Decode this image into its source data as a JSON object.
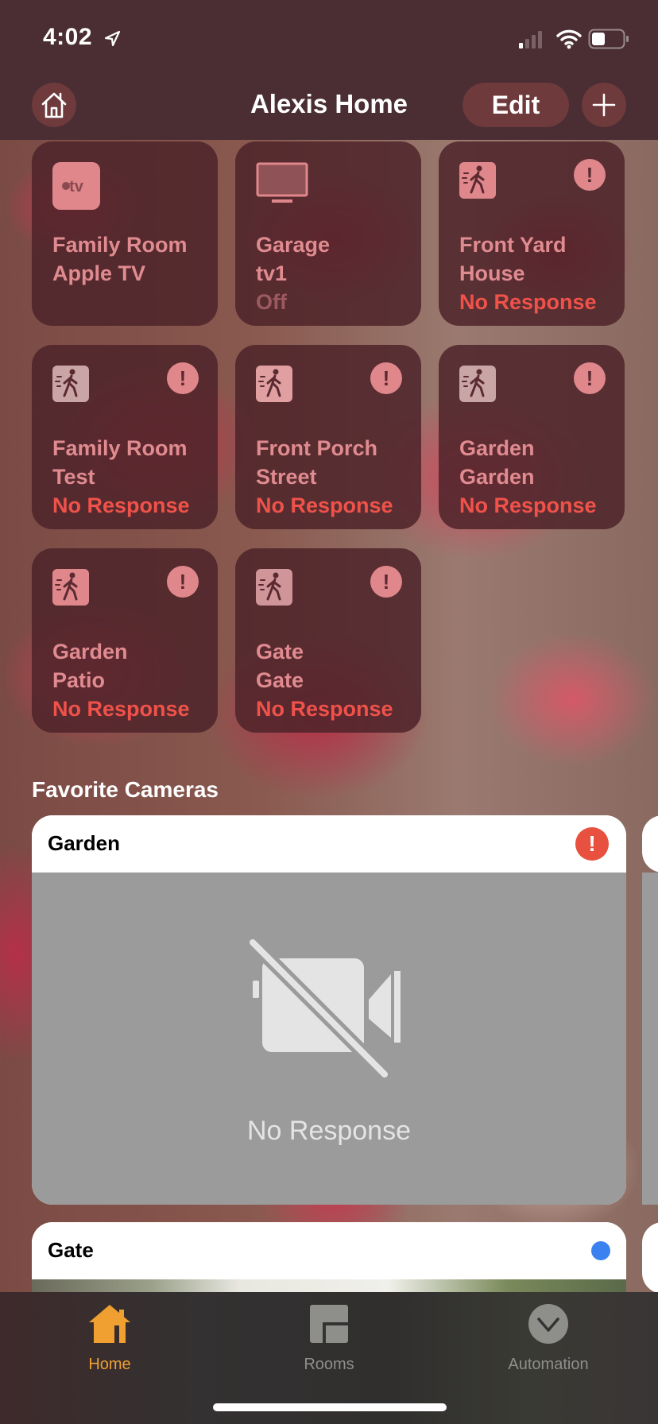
{
  "status_bar": {
    "time": "4:02",
    "icons": [
      "location-arrow-icon",
      "cellular-signal-icon",
      "wifi-icon",
      "battery-icon"
    ]
  },
  "nav": {
    "title": "Alexis Home",
    "edit_label": "Edit",
    "home_icon": "house-icon",
    "add_icon": "plus-icon"
  },
  "accessories": [
    {
      "line1": "Family Room",
      "line2": "Apple TV",
      "status": "",
      "icon": "apple-tv-icon",
      "alert": false
    },
    {
      "line1": "Garage",
      "line2": "tv1",
      "status": "Off",
      "icon": "tv-icon",
      "alert": false
    },
    {
      "line1": "Front Yard",
      "line2": "House",
      "status": "No Response",
      "icon": "motion-sensor-icon",
      "alert": true
    },
    {
      "line1": "Family Room",
      "line2": "Test",
      "status": "No Response",
      "icon": "motion-sensor-icon",
      "alert": true
    },
    {
      "line1": "Front Porch",
      "line2": "Street",
      "status": "No Response",
      "icon": "motion-sensor-icon",
      "alert": true
    },
    {
      "line1": "Garden",
      "line2": "Garden",
      "status": "No Response",
      "icon": "motion-sensor-icon",
      "alert": true
    },
    {
      "line1": "Garden",
      "line2": "Patio",
      "status": "No Response",
      "icon": "motion-sensor-icon",
      "alert": true
    },
    {
      "line1": "Gate",
      "line2": "Gate",
      "status": "No Response",
      "icon": "motion-sensor-icon",
      "alert": true
    }
  ],
  "cameras": {
    "section_title": "Favorite Cameras",
    "items": [
      {
        "name": "Garden",
        "status_text": "No Response",
        "indicator": "alert"
      },
      {
        "name": "Gate",
        "indicator": "live-dot"
      }
    ]
  },
  "tab_bar": {
    "tabs": [
      {
        "label": "Home",
        "icon": "home-tab-icon",
        "active": true
      },
      {
        "label": "Rooms",
        "icon": "rooms-tab-icon",
        "active": false
      },
      {
        "label": "Automation",
        "icon": "automation-tab-icon",
        "active": false
      }
    ]
  },
  "colors": {
    "accent": "#f0a030",
    "error": "#f0524a",
    "live": "#3b82f0"
  }
}
